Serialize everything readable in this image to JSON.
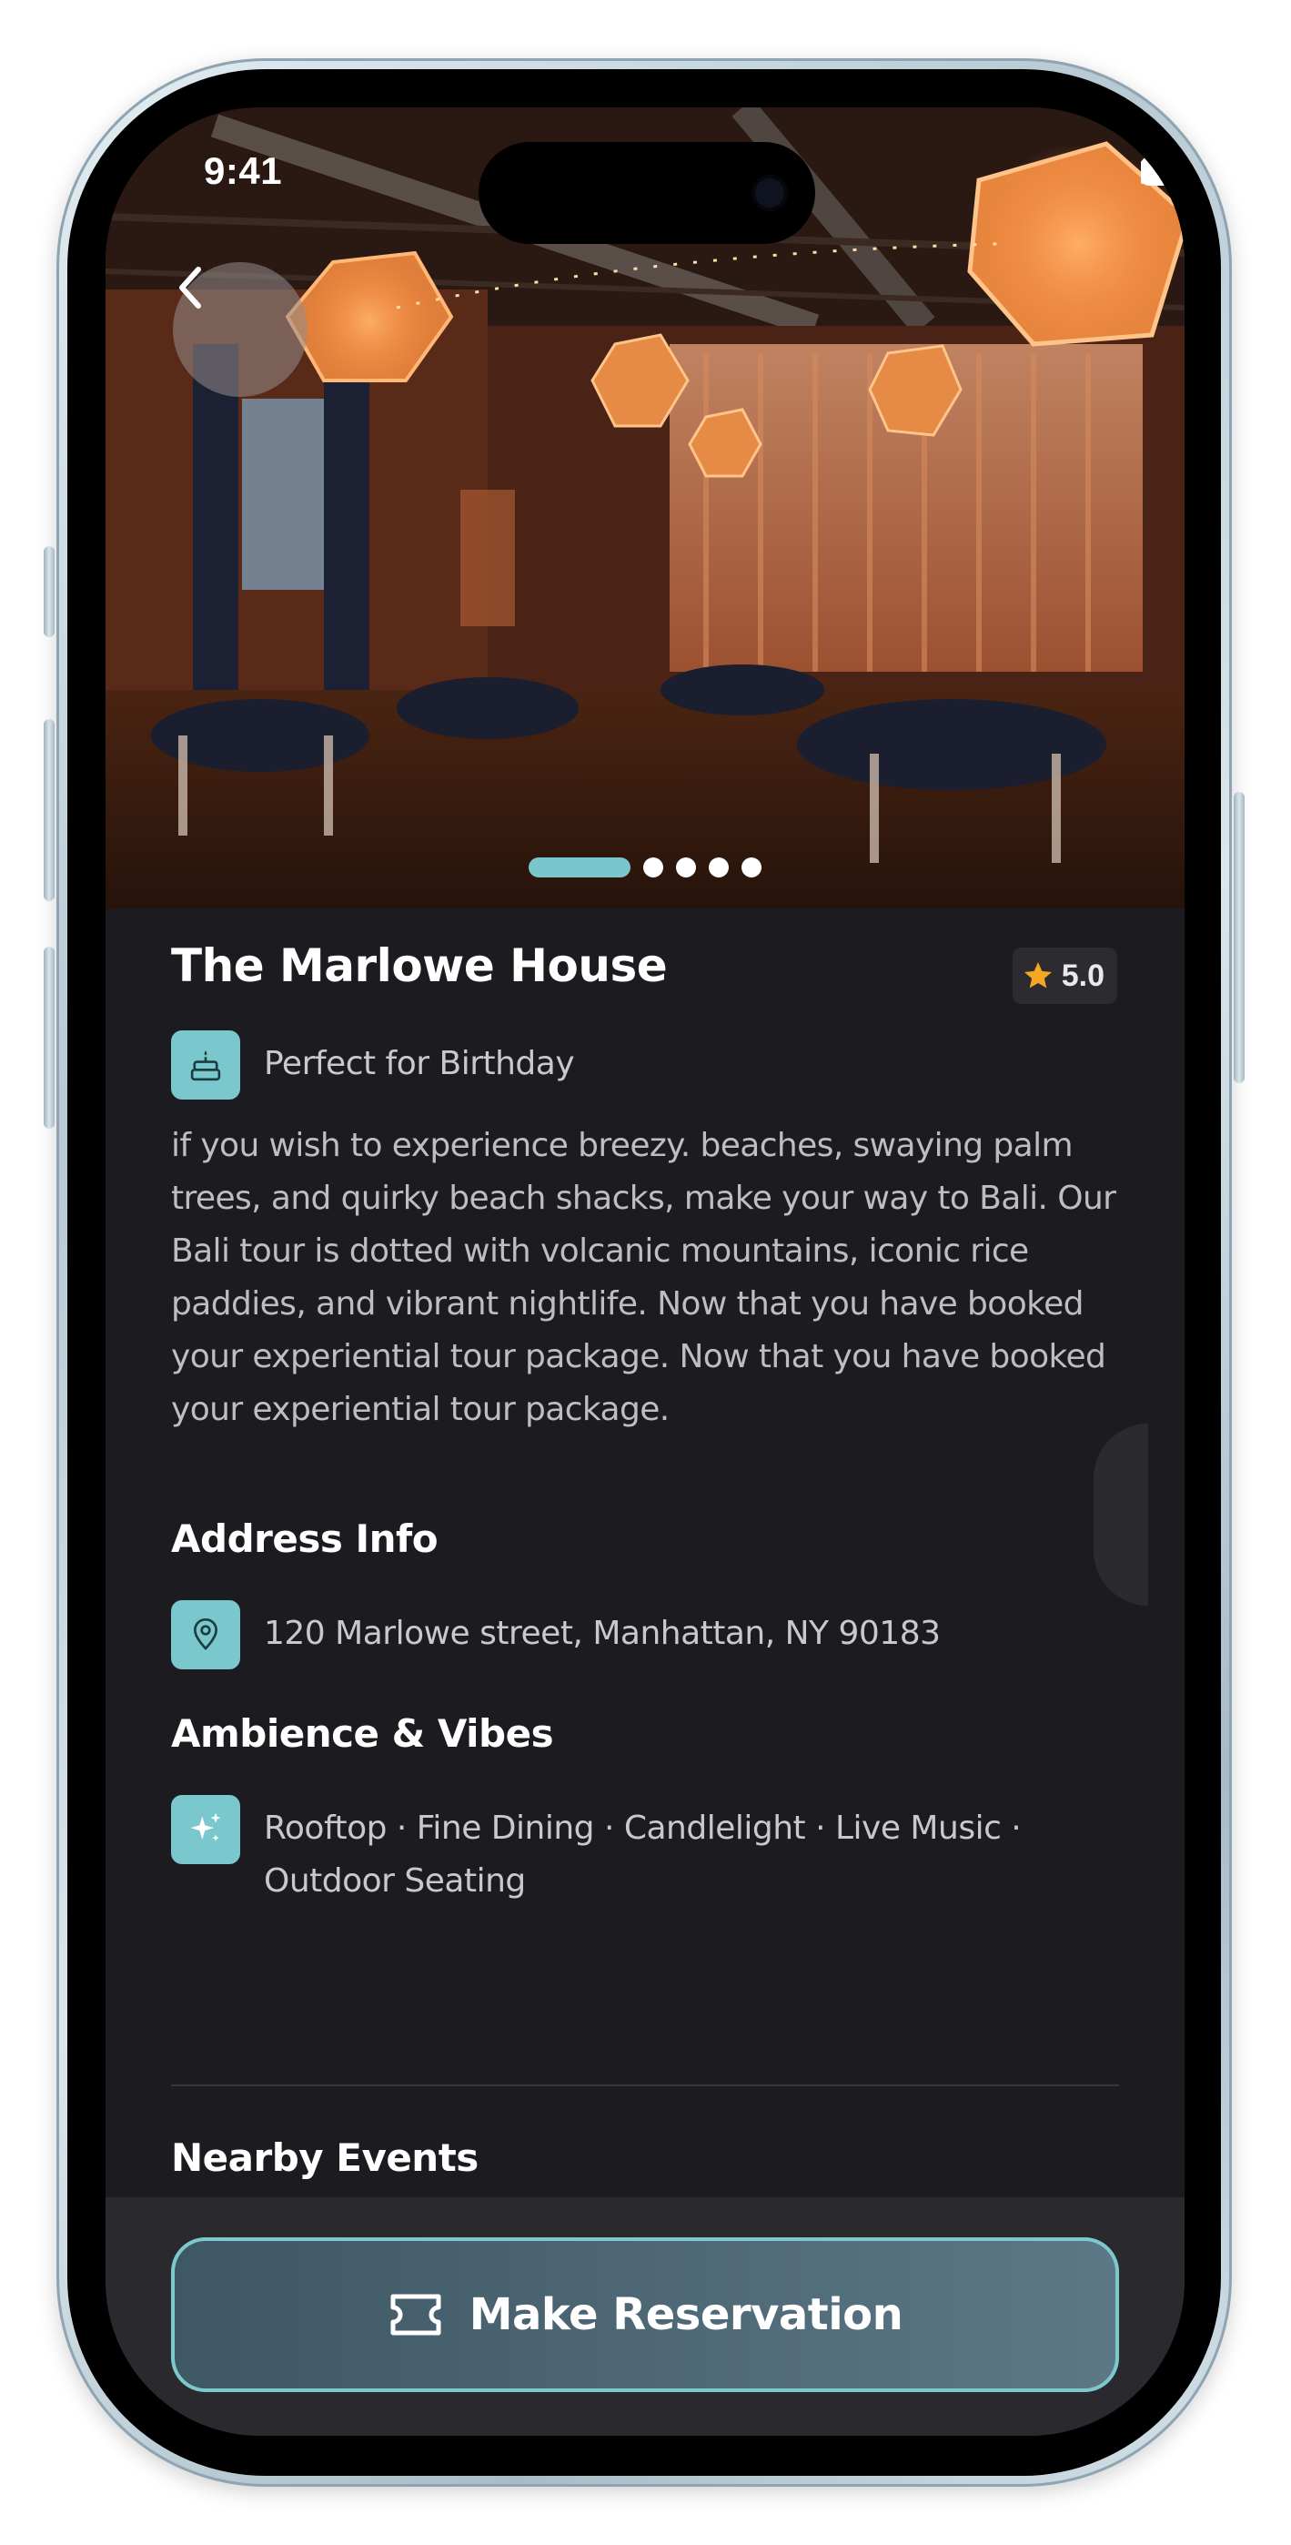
{
  "status_bar": {
    "time": "9:41"
  },
  "carousel": {
    "total": 5,
    "active_index": 0
  },
  "venue": {
    "name": "The Marlowe House",
    "rating": "5.0",
    "occasion": "Perfect for Birthday",
    "description": "if you wish to experience breezy. beaches, swaying palm trees, and quirky beach shacks, make your way to Bali. Our Bali tour is dotted with volcanic mountains, iconic rice paddies, and vibrant nightlife. Now that you have booked your experiential tour package. Now that you have booked your experiential tour package."
  },
  "address": {
    "title": "Address Info",
    "text": "120 Marlowe street, Manhattan, NY 90183"
  },
  "ambience": {
    "title": "Ambience & Vibes",
    "text": "Rooftop · Fine Dining · Candlelight · Live Music · Outdoor Seating"
  },
  "nearby": {
    "title": "Nearby Events"
  },
  "cta": {
    "label": "Make Reservation"
  },
  "colors": {
    "accent": "#7ac7cd",
    "background": "#1c1b20",
    "star": "#f5a623",
    "cta_gradient_start": "#3e5764",
    "cta_gradient_end": "#5c7886"
  },
  "icons": {
    "back": "chevron-left-icon",
    "occasion": "cake-icon",
    "address": "location-pin-icon",
    "ambience": "sparkles-icon",
    "rating": "star-icon",
    "cta": "ticket-icon"
  }
}
